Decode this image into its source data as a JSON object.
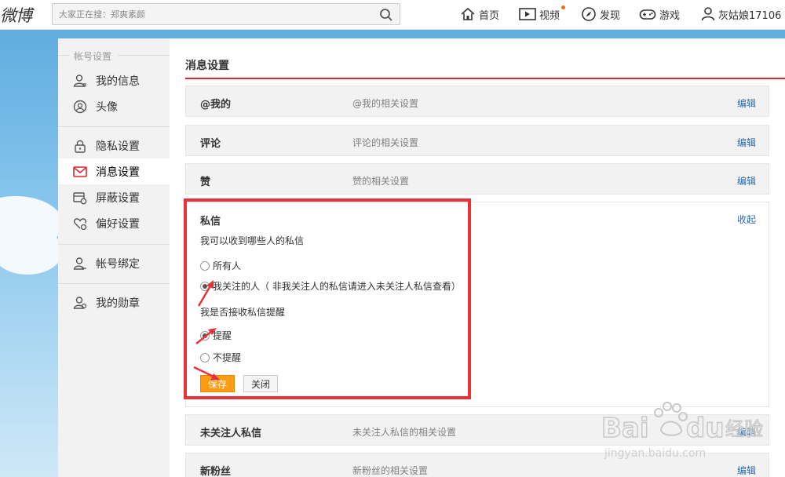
{
  "header": {
    "logo": "微博",
    "search_placeholder": "大家正在搜：郑爽素颜",
    "nav": [
      {
        "label": "首页",
        "icon": "home-icon"
      },
      {
        "label": "视频",
        "icon": "video-icon"
      },
      {
        "label": "发现",
        "icon": "compass-icon"
      },
      {
        "label": "游戏",
        "icon": "gamepad-icon"
      },
      {
        "label": "灰姑娘17106",
        "icon": "user-icon"
      }
    ]
  },
  "sidebar": {
    "section_title": "帐号设置",
    "items": [
      {
        "label": "我的信息",
        "icon": "user-info-icon"
      },
      {
        "label": "头像",
        "icon": "avatar-icon"
      },
      {
        "label": "隐私设置",
        "icon": "lock-icon"
      },
      {
        "label": "消息设置",
        "icon": "message-icon",
        "active": true
      },
      {
        "label": "屏蔽设置",
        "icon": "block-icon"
      },
      {
        "label": "偏好设置",
        "icon": "heart-gear-icon"
      },
      {
        "label": "帐号绑定",
        "icon": "account-bind-icon"
      },
      {
        "label": "我的勋章",
        "icon": "medal-icon"
      }
    ]
  },
  "main": {
    "title": "消息设置",
    "rows": [
      {
        "label": "@我的",
        "desc": "@我的相关设置",
        "action": "编辑"
      },
      {
        "label": "评论",
        "desc": "评论的相关设置",
        "action": "编辑"
      },
      {
        "label": "赞",
        "desc": "赞的相关设置",
        "action": "编辑"
      }
    ],
    "private_msg": {
      "title": "私信",
      "collapse": "收起",
      "question1": "我可以收到哪些人的私信",
      "options1": [
        "所有人",
        "我关注的人（ 非我关注人的私信请进入未关注人私信查看）"
      ],
      "selected1": 1,
      "question2": "我是否接收私信提醒",
      "options2": [
        "提醒",
        "不提醒"
      ],
      "selected2": 0,
      "save": "保存",
      "close": "关闭"
    },
    "rows_after": [
      {
        "label": "未关注人私信",
        "desc": "未关注人私信的相关设置",
        "action": "编辑"
      },
      {
        "label": "新粉丝",
        "desc": "新粉丝的相关设置",
        "action": "编辑"
      }
    ]
  },
  "watermark": {
    "brand": "Bai du 经验",
    "url": "jingyan.baidu.com"
  },
  "colors": {
    "accent_red": "#e0242c",
    "save_orange": "#fd9b12",
    "link_blue": "#2a6ab0",
    "annotation_red": "#e8323a"
  }
}
